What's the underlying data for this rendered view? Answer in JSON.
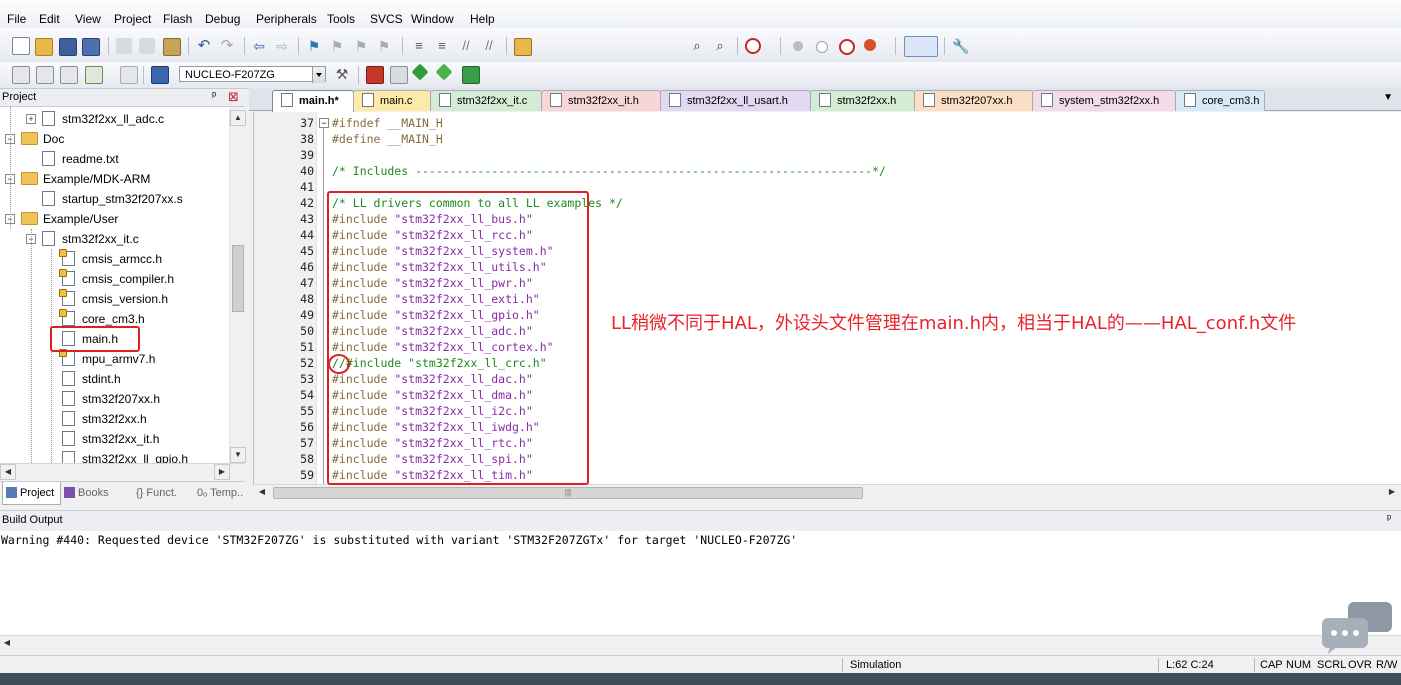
{
  "menu": [
    "File",
    "Edit",
    "View",
    "Project",
    "Flash",
    "Debug",
    "Peripherals",
    "Tools",
    "SVCS",
    "Window",
    "Help"
  ],
  "toolbar": {
    "target_select": "NUCLEO-F207ZG",
    "find_input": ""
  },
  "project_panel": {
    "title": "Project",
    "pin_glyph": "ᵖ",
    "close_glyph": "⊠",
    "tree": [
      {
        "label": "stm32f2xx_ll_adc.c",
        "kind": "file",
        "expander": "⊞"
      },
      {
        "label": "Doc",
        "kind": "folder",
        "expander": "⊟"
      },
      {
        "label": "readme.txt",
        "kind": "file"
      },
      {
        "label": "Example/MDK-ARM",
        "kind": "folder",
        "expander": "⊟"
      },
      {
        "label": "startup_stm32f207xx.s",
        "kind": "file"
      },
      {
        "label": "Example/User",
        "kind": "folder",
        "expander": "⊟"
      },
      {
        "label": "stm32f2xx_it.c",
        "kind": "file",
        "expander": "⊟"
      },
      {
        "label": "cmsis_armcc.h",
        "kind": "header"
      },
      {
        "label": "cmsis_compiler.h",
        "kind": "header"
      },
      {
        "label": "cmsis_version.h",
        "kind": "header"
      },
      {
        "label": "core_cm3.h",
        "kind": "header"
      },
      {
        "label": "main.h",
        "kind": "file"
      },
      {
        "label": "mpu_armv7.h",
        "kind": "header"
      },
      {
        "label": "stdint.h",
        "kind": "file"
      },
      {
        "label": "stm32f207xx.h",
        "kind": "file"
      },
      {
        "label": "stm32f2xx.h",
        "kind": "file"
      },
      {
        "label": "stm32f2xx_it.h",
        "kind": "file"
      },
      {
        "label": "stm32f2xx_ll_gpio.h",
        "kind": "file"
      }
    ],
    "bottom_tabs": [
      "Project",
      "Books",
      "{} Funct...",
      "0ₒ Temp..."
    ]
  },
  "editor": {
    "tabs": [
      {
        "label": "main.h*",
        "color": "#ffffff",
        "active": true
      },
      {
        "label": "main.c",
        "color": "#fde9a8"
      },
      {
        "label": "stm32f2xx_it.c",
        "color": "#d4ecd3"
      },
      {
        "label": "stm32f2xx_it.h",
        "color": "#f6d6d6"
      },
      {
        "label": "stm32f2xx_ll_usart.h",
        "color": "#e3d8f2"
      },
      {
        "label": "stm32f2xx.h",
        "color": "#d4ecd3"
      },
      {
        "label": "stm32f207xx.h",
        "color": "#fbdfc4"
      },
      {
        "label": "system_stm32f2xx.h",
        "color": "#f3dbe9"
      },
      {
        "label": "core_cm3.h",
        "color": "#d9e9f6"
      }
    ],
    "lines": [
      {
        "n": "37",
        "text": "#ifndef __MAIN_H"
      },
      {
        "n": "38",
        "text": "#define __MAIN_H"
      },
      {
        "n": "39",
        "text": ""
      },
      {
        "n": "40",
        "text": "/* Includes ------------------------------------------------------------------*/"
      },
      {
        "n": "41",
        "text": ""
      },
      {
        "n": "42",
        "text": "/* LL drivers common to all LL examples */"
      },
      {
        "n": "43",
        "text": "#include \"stm32f2xx_ll_bus.h\""
      },
      {
        "n": "44",
        "text": "#include \"stm32f2xx_ll_rcc.h\""
      },
      {
        "n": "45",
        "text": "#include \"stm32f2xx_ll_system.h\""
      },
      {
        "n": "46",
        "text": "#include \"stm32f2xx_ll_utils.h\""
      },
      {
        "n": "47",
        "text": "#include \"stm32f2xx_ll_pwr.h\""
      },
      {
        "n": "48",
        "text": "#include \"stm32f2xx_ll_exti.h\""
      },
      {
        "n": "49",
        "text": "#include \"stm32f2xx_ll_gpio.h\""
      },
      {
        "n": "50",
        "text": "#include \"stm32f2xx_ll_adc.h\""
      },
      {
        "n": "51",
        "text": "#include \"stm32f2xx_ll_cortex.h\""
      },
      {
        "n": "52",
        "text": "//#include \"stm32f2xx_ll_crc.h\""
      },
      {
        "n": "53",
        "text": "#include \"stm32f2xx_ll_dac.h\""
      },
      {
        "n": "54",
        "text": "#include \"stm32f2xx_ll_dma.h\""
      },
      {
        "n": "55",
        "text": "#include \"stm32f2xx_ll_i2c.h\""
      },
      {
        "n": "56",
        "text": "#include \"stm32f2xx_ll_iwdg.h\""
      },
      {
        "n": "57",
        "text": "#include \"stm32f2xx_ll_rtc.h\""
      },
      {
        "n": "58",
        "text": "#include \"stm32f2xx_ll_spi.h\""
      },
      {
        "n": "59",
        "text": "#include \"stm32f2xx_ll_tim.h\""
      }
    ],
    "hscroll_grip": "|||"
  },
  "annotation": "LL稍微不同于HAL，外设头文件管理在main.h内，相当于HAL的——HAL_conf.h文件",
  "build_output": {
    "title": "Build Output",
    "pin_glyph": "ᵖ",
    "text": "Warning #440: Requested device 'STM32F207ZG' is substituted with variant 'STM32F207ZGTx' for target 'NUCLEO-F207ZG'"
  },
  "status": {
    "mode": "Simulation",
    "position": "L:62 C:24",
    "cap": "CAP",
    "num": "NUM",
    "scrl": "SCRL",
    "ovr": "OVR",
    "rw": "R/W"
  },
  "colors": {
    "annotation_red": "#e8232a",
    "keyword_brown": "#8a6b3a",
    "string_purple": "#8b2aa8",
    "comment_green": "#1b8a1b"
  }
}
